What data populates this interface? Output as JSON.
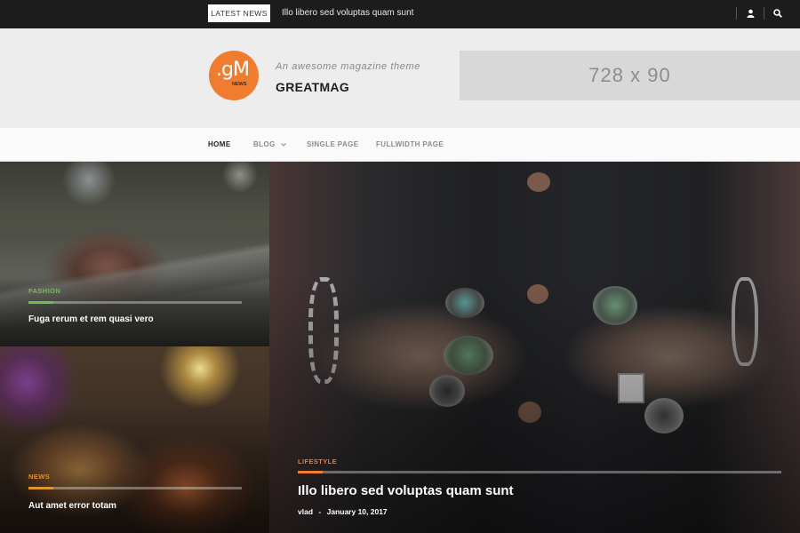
{
  "topbar": {
    "latest_label": "LATEST NEWS",
    "ticker_title": "Illo libero sed voluptas quam sunt",
    "icons": [
      "user-icon",
      "search-icon"
    ]
  },
  "header": {
    "logo_text": ".gM",
    "logo_sub": "NEWS",
    "tagline": "An awesome magazine theme",
    "site_title": "GREATMAG",
    "ad_text": "728 x 90",
    "colors": {
      "accent": "#ef7c2f",
      "header_bg": "#ededed",
      "ad_bg": "#d8d8d8"
    }
  },
  "nav": {
    "items": [
      {
        "label": "HOME",
        "active": true
      },
      {
        "label": "BLOG",
        "has_dropdown": true
      },
      {
        "label": "SINGLE PAGE"
      },
      {
        "label": "FULLWIDTH PAGE"
      }
    ]
  },
  "posts": [
    {
      "category": "FASHION",
      "category_color": "#6fbf4a",
      "title": "Fuga rerum et rem quasi vero"
    },
    {
      "category": "NEWS",
      "category_color": "#e0922c",
      "title": "Aut amet error totam"
    },
    {
      "category": "LIFESTYLE",
      "category_color": "#ef7c2f",
      "title": "Illo libero sed voluptas quam sunt",
      "author": "vlad",
      "separator": "-",
      "date": "January 10, 2017"
    }
  ]
}
